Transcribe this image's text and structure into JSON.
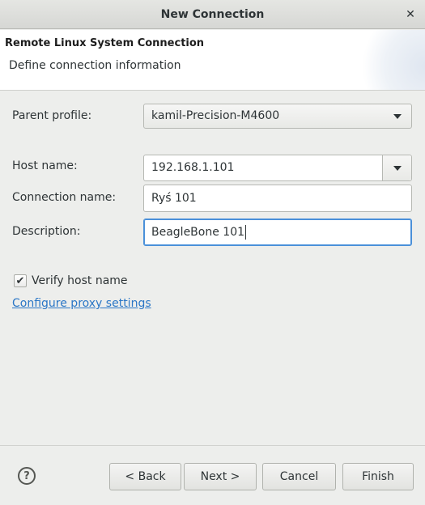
{
  "window": {
    "title": "New Connection",
    "close_glyph": "✕"
  },
  "header": {
    "title": "Remote Linux System Connection",
    "subtitle": "Define connection information"
  },
  "form": {
    "parent_profile": {
      "label": "Parent profile:",
      "value": "kamil-Precision-M4600"
    },
    "host_name": {
      "label": "Host name:",
      "value": "192.168.1.101"
    },
    "connection_name": {
      "label": "Connection name:",
      "value": "Ryś 101"
    },
    "description": {
      "label": "Description:",
      "value": "BeagleBone 101"
    },
    "verify_host": {
      "label": "Verify host name",
      "checked": true,
      "check_glyph": "✔"
    },
    "proxy_link": "Configure proxy settings"
  },
  "footer": {
    "help_glyph": "?",
    "back": "< Back",
    "next": "Next >",
    "cancel": "Cancel",
    "finish": "Finish"
  },
  "colors": {
    "link": "#2a76c6",
    "focus": "#4a90d9"
  }
}
